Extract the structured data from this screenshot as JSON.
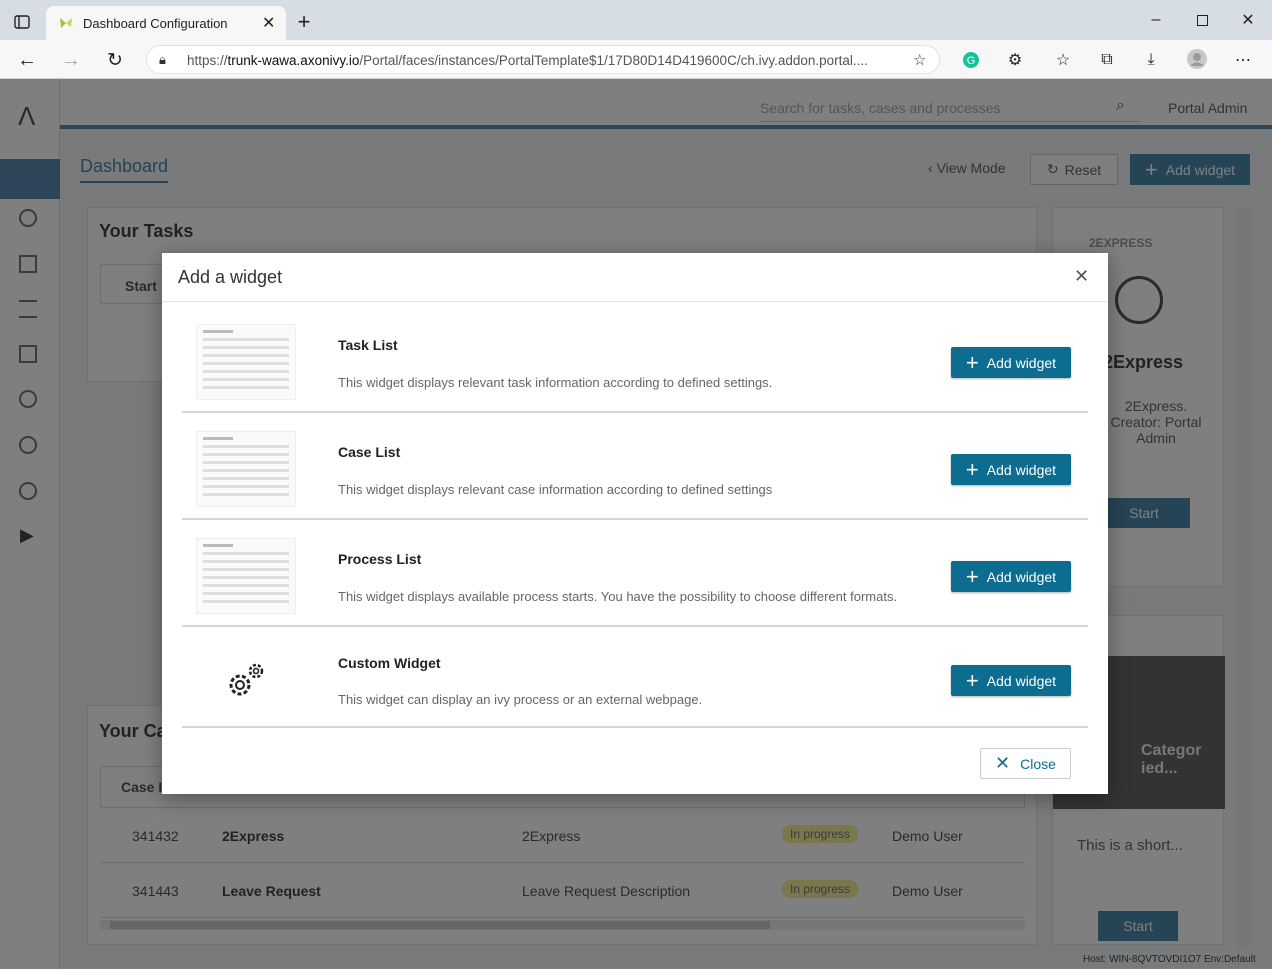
{
  "browser": {
    "tab_title": "Dashboard Configuration",
    "url_prefix": "https://",
    "url_host": "trunk-wawa.axonivy.io",
    "url_path": "/Portal/faces/instances/PortalTemplate$1/17D80D14D419600C/ch.ivy.addon.portal...."
  },
  "header": {
    "search_placeholder": "Search for tasks, cases and processes",
    "user": "Portal Admin"
  },
  "page": {
    "title": "Dashboard",
    "view_mode": "View Mode",
    "reset": "Reset",
    "add_widget": "Add widget"
  },
  "tasks_widget": {
    "title": "Your Tasks",
    "col_start": "Start"
  },
  "cases_widget": {
    "title": "Your Ca",
    "col_case": "Case Id",
    "rows": [
      {
        "id": "341432",
        "name": "2Express",
        "desc": "2Express",
        "state": "In progress",
        "creator": "Demo User"
      },
      {
        "id": "341443",
        "name": "Leave Request",
        "desc": "Leave Request Description",
        "state": "In progress",
        "creator": "Demo User"
      }
    ]
  },
  "side_cards": {
    "top_label": "2EXPRESS",
    "top_title": "2Express",
    "top_desc": "2Express. Creator: Portal Admin",
    "start": "Start",
    "cat_label": "Categor ied...",
    "short": "This is a short..."
  },
  "footer_host": "Host: WIN-8QVTOVDI1O7 Env:Default",
  "modal": {
    "title": "Add a widget",
    "button_label": "Add widget",
    "close_label": "Close",
    "widgets": [
      {
        "title": "Task List",
        "desc": "This widget displays relevant task information according to defined settings."
      },
      {
        "title": "Case List",
        "desc": "This widget displays relevant case information according to defined settings"
      },
      {
        "title": "Process List",
        "desc": "This widget displays available process starts. You have the possibility to choose different formats."
      },
      {
        "title": "Custom Widget",
        "desc": "This widget can display an ivy process or an external webpage."
      }
    ]
  }
}
